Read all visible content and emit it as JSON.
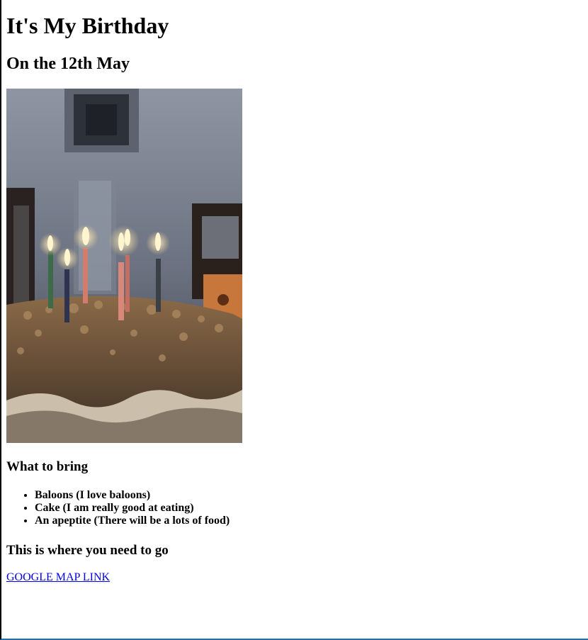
{
  "header": {
    "title": "It's My Birthday",
    "subtitle": "On the 12th May"
  },
  "image": {
    "subject": "birthday-cake-with-candles"
  },
  "bring": {
    "heading": "What to bring",
    "items": [
      "Baloons (I love baloons)",
      "Cake (I am really good at eating)",
      "An apeptite (There will be a lots of food)"
    ]
  },
  "location": {
    "heading": "This is where you need to go",
    "link_label": "GOOGLE MAP LINK"
  },
  "colors": {
    "link": "#0000ee",
    "left_border": "#000000",
    "bottom_border": "#1a6fb5"
  }
}
